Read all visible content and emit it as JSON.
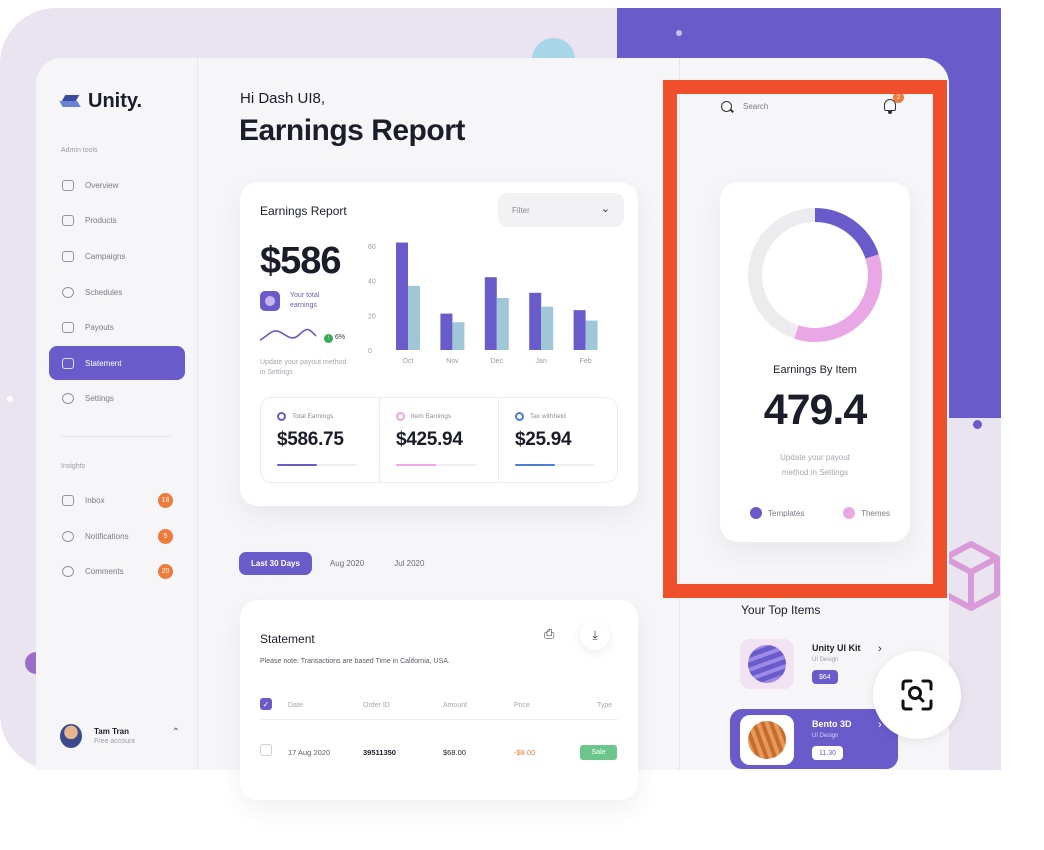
{
  "colors": {
    "accent": "#6a5bcb",
    "pink": "#e9a7e6",
    "chart_light": "#9fc7d8",
    "orange_badge": "#ef7a3c",
    "highlight_border": "#ef4f2b",
    "sale_green": "#6cc58a"
  },
  "brand": {
    "name": "Unity."
  },
  "sidebar": {
    "admin_label": "Admin tools",
    "items": [
      {
        "label": "Overview",
        "icon": "overview-icon"
      },
      {
        "label": "Products",
        "icon": "bag-icon"
      },
      {
        "label": "Campaigns",
        "icon": "campaign-icon"
      },
      {
        "label": "Schedules",
        "icon": "clock-icon"
      },
      {
        "label": "Payouts",
        "icon": "wallet-icon"
      },
      {
        "label": "Statement",
        "icon": "document-icon",
        "active": true
      },
      {
        "label": "Settings",
        "icon": "gear-icon"
      }
    ],
    "insights_label": "Insights",
    "insights": [
      {
        "label": "Inbox",
        "badge": "18",
        "icon": "inbox-icon"
      },
      {
        "label": "Notifications",
        "badge": "5",
        "icon": "bell-icon"
      },
      {
        "label": "Comments",
        "badge": "20",
        "icon": "comment-icon"
      }
    ],
    "user": {
      "name": "Tam Tran",
      "plan": "Free account"
    }
  },
  "header": {
    "greeting": "Hi Dash UI8,",
    "title": "Earnings Report"
  },
  "earnings_card": {
    "title": "Earnings Report",
    "filter_label": "Filter",
    "amount": "$586",
    "sublabel": "Your total earnings",
    "growth": "6%",
    "note": "Update your payout method in Settings",
    "stats": [
      {
        "label": "Total Earnings",
        "value": "$586.75",
        "color": "#6a5bcb",
        "progress": 0.5
      },
      {
        "label": "Item Earnings",
        "value": "$425.94",
        "color": "#e9a7e6",
        "progress": 0.5
      },
      {
        "label": "Tax withheld",
        "value": "$25.94",
        "color": "#4a7fd8",
        "progress": 0.5
      }
    ]
  },
  "chart_data": {
    "type": "bar",
    "categories": [
      "Oct",
      "Nov",
      "Dec",
      "Jan",
      "Feb"
    ],
    "series": [
      {
        "values": [
          62,
          21,
          42,
          33,
          23
        ]
      },
      {
        "values": [
          37,
          16,
          30,
          25,
          17
        ]
      }
    ],
    "yticks": [
      "60",
      "40",
      "20",
      "0"
    ],
    "ylim": [
      0,
      60
    ],
    "title": "",
    "xlabel": "",
    "ylabel": ""
  },
  "tabs": [
    "Last 30 Days",
    "Aug 2020",
    "Jul 2020"
  ],
  "statement": {
    "title": "Statement",
    "note": "Please note: Transactions are based Time in California, USA.",
    "columns": [
      "Date",
      "Order ID",
      "Amount",
      "Price",
      "Type"
    ],
    "rows": [
      {
        "date": "17 Aug 2020",
        "order_id": "39511350",
        "amount": "$68.00",
        "price": "-$8.00",
        "type": "Sale"
      }
    ]
  },
  "right_panel": {
    "search_placeholder": "Search",
    "bell_badge": "2",
    "earnings_by_item": {
      "title": "Earnings By Item",
      "value": "479.4",
      "note": "Update your payout method in Settings",
      "legend": [
        {
          "label": "Templates",
          "color": "#6a5bcb"
        },
        {
          "label": "Themes",
          "color": "#e9a7e6"
        }
      ],
      "donut": {
        "templates_fraction": 0.2,
        "themes_fraction": 0.35
      }
    },
    "top_items_title": "Your Top Items",
    "top_items": [
      {
        "name": "Unity UI Kit",
        "category": "UI Design",
        "price": "$64"
      },
      {
        "name": "Bento 3D",
        "category": "UI Design",
        "price": "11.30"
      }
    ]
  }
}
